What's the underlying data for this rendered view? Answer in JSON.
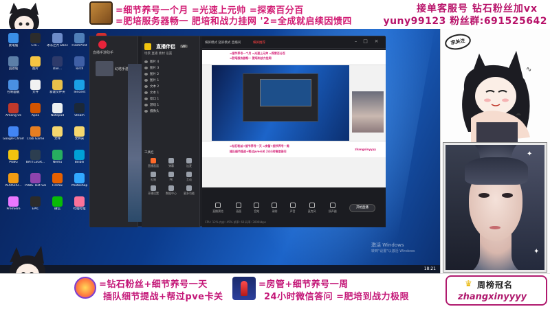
{
  "top_banner": {
    "line1": "=细节养号一个月 =光速上元帅 =探索百分百",
    "line2": "=肥培服务器畅一 肥培和战力挂网 '2=全成就启续因馈四",
    "right_title": "接单客服号    钻石粉丝加vx",
    "right_contact": "yuny99123 粉丝群:691525642"
  },
  "desktop": {
    "icons": [
      {
        "label": "此电脑",
        "color": "#3a8ee6"
      },
      {
        "label": "Cre...",
        "color": "#2c2c2c"
      },
      {
        "label": "冰冻之力 Dance of F...",
        "color": "#6d8cc9"
      },
      {
        "label": "FlashPrint",
        "color": "#4f7fb8"
      },
      {
        "label": "小红莲编辑",
        "color": "#d32f2f"
      },
      {
        "label": "回收站",
        "color": "#5c7fa8"
      },
      {
        "label": "图片",
        "color": "#f5c542"
      },
      {
        "label": "Dan...",
        "color": "#2d3a6a"
      },
      {
        "label": "Torch",
        "color": "#3f5fa5"
      },
      {
        "label": "剪映专业版",
        "color": "#111111"
      },
      {
        "label": "控制面板",
        "color": "#4a90e2"
      },
      {
        "label": "文件",
        "color": "#f2f2f2"
      },
      {
        "label": "新建文件夹",
        "color": "#e8c04a"
      },
      {
        "label": "Tencent",
        "color": "#1aa0e6"
      },
      {
        "label": "QQ",
        "color": "#38b0ef"
      },
      {
        "label": "Among Us",
        "color": "#c0392b"
      },
      {
        "label": "Apex",
        "color": "#d35400"
      },
      {
        "label": "Notepad",
        "color": "#ecf0f1"
      },
      {
        "label": "Steam",
        "color": "#1b2838"
      },
      {
        "label": "WeGame",
        "color": "#e74c3c"
      },
      {
        "label": "Google Chrome",
        "color": "#4285f4"
      },
      {
        "label": "Crab Game",
        "color": "#e67e22"
      },
      {
        "label": "文件",
        "color": "#f5d76e"
      },
      {
        "label": "文件夹",
        "color": "#f5d76e"
      },
      {
        "label": "小丑",
        "color": "#9b59b6"
      },
      {
        "label": "PUBG",
        "color": "#f1c40f"
      },
      {
        "label": "BATTLEGR...",
        "color": "#2c3e50"
      },
      {
        "label": "Nemu",
        "color": "#27ae60"
      },
      {
        "label": "Bilibili",
        "color": "#00a1d6"
      },
      {
        "label": "Live",
        "color": "#34495e"
      },
      {
        "label": "PLAYERU...",
        "color": "#f39c12"
      },
      {
        "label": "PUBG Test Server",
        "color": "#8e44ad"
      },
      {
        "label": "Firefox",
        "color": "#e66000"
      },
      {
        "label": "Photoshop",
        "color": "#31a8ff"
      },
      {
        "label": "微信",
        "color": "#2aae67"
      },
      {
        "label": "Premiere",
        "color": "#ea77ff"
      },
      {
        "label": "EPIC",
        "color": "#2b2b2b"
      },
      {
        "label": "微信",
        "color": "#09bb07"
      },
      {
        "label": "哔哩哔哩",
        "color": "#fb7299"
      },
      {
        "label": "文件",
        "color": "#f5d76e"
      }
    ],
    "watermark": "激活 Windows",
    "watermark_sub": "转到\"设置\"以激活 Windows",
    "time": "18:21"
  },
  "app": {
    "left_title": "直播手游助手",
    "game_label": "幻塔手游",
    "mid_title": "直播伴侣",
    "mid_version": "VIP",
    "mid_tabs": "场景  直播  素材  设置",
    "scenes": [
      "图片 4",
      "图片 3",
      "图片 2",
      "图片 1",
      "文本 2",
      "文本 1",
      "窗口 1",
      "游戏 1",
      "摄像头"
    ],
    "section_label": "工具栏",
    "tools": [
      {
        "label": "直播画面",
        "hot": true
      },
      {
        "label": "弹幕",
        "hot": false
      },
      {
        "label": "连麦",
        "hot": false
      },
      {
        "label": "礼物",
        "hot": false
      },
      {
        "label": "PK",
        "hot": false
      },
      {
        "label": "互动",
        "hot": false
      },
      {
        "label": "开播设置",
        "hot": false
      },
      {
        "label": "数据中心",
        "hot": false
      },
      {
        "label": "更多功能",
        "hot": false
      }
    ],
    "preview_topbar": "横屏模式 竖屏模式 直播间",
    "preview_topbar_red": "横屏推荐",
    "preview_banner1": "=细节养号一个月 =光速上元帅 =探索百分百",
    "preview_banner2": "=肥培服务器畅一 肥培和战力挂网",
    "preview_bottom1": "=钻石粉丝+细节养号一天 =房管+细节养号一周",
    "preview_bottom2": "插队细节提战+帮过pve卡关 24小时微信答问",
    "preview_name": "zhangxinyyyy",
    "controls": [
      "直播预览",
      "画面",
      "音效",
      "录制",
      "声音",
      "麦克风",
      "扬声器"
    ],
    "live_button": "开始直播",
    "status": "CPU: 12%  内存: 45%  帧率: 60  码率: 3000kbps"
  },
  "right_panel": {
    "follow_badge": "求关注"
  },
  "bottom_banner": {
    "line1": "=钻石粉丝+细节养号一天",
    "line2": "插队细节提战+帮过pve卡关",
    "line3": "=房管+细节养号一周",
    "line4": "24小时微信答问 =肥培到战力极限",
    "crown_title": "周榜冠名",
    "name": "zhangxinyyyy"
  }
}
